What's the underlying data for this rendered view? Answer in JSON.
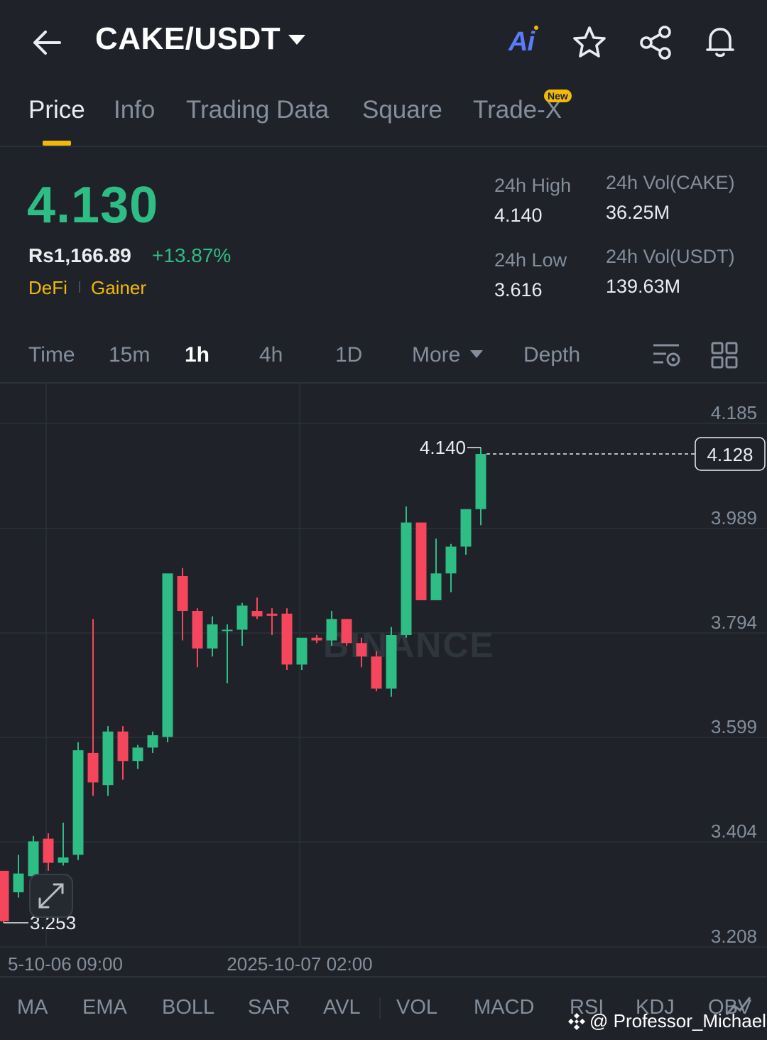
{
  "header": {
    "pair": "CAKE/USDT",
    "ai_label": "Ai",
    "icons": [
      "back-arrow-icon",
      "star-icon",
      "share-icon",
      "bell-icon"
    ]
  },
  "tabs": [
    {
      "label": "Price",
      "active": true
    },
    {
      "label": "Info"
    },
    {
      "label": "Trading Data"
    },
    {
      "label": "Square"
    },
    {
      "label": "Trade-X",
      "badge": "New"
    }
  ],
  "price": {
    "last": "4.130",
    "fiat": "Rs1,166.89",
    "change_pct": "+13.87%",
    "tags": [
      "DeFi",
      "Gainer"
    ]
  },
  "stats": {
    "high_label": "24h High",
    "high": "4.140",
    "low_label": "24h Low",
    "low": "3.616",
    "vol_base_label": "24h Vol(CAKE)",
    "vol_base": "36.25M",
    "vol_quote_label": "24h Vol(USDT)",
    "vol_quote": "139.63M"
  },
  "intervals": {
    "items": [
      "Time",
      "15m",
      "1h",
      "4h",
      "1D"
    ],
    "active": "1h",
    "more": "More",
    "depth": "Depth"
  },
  "colors": {
    "up": "#2ebd85",
    "down": "#f6465d",
    "accent": "#f0b90b",
    "background": "#1f2329"
  },
  "chart_data": {
    "type": "candlestick",
    "y_ticks": [
      "4.185",
      "3.989",
      "3.794",
      "3.599",
      "3.404",
      "3.208"
    ],
    "ylim": [
      3.208,
      4.185
    ],
    "x_labels": [
      "5-10-06 09:00",
      "2025-10-07 02:00"
    ],
    "current_price": "4.128",
    "high_marker": "4.140",
    "low_marker": "3.253",
    "watermark": "BINANCE",
    "candles": [
      {
        "o": 3.35,
        "h": 3.35,
        "l": 3.253,
        "c": 3.256
      },
      {
        "o": 3.31,
        "h": 3.38,
        "l": 3.3,
        "c": 3.345
      },
      {
        "o": 3.34,
        "h": 3.415,
        "l": 3.32,
        "c": 3.405
      },
      {
        "o": 3.41,
        "h": 3.42,
        "l": 3.35,
        "c": 3.365
      },
      {
        "o": 3.365,
        "h": 3.44,
        "l": 3.36,
        "c": 3.375
      },
      {
        "o": 3.38,
        "h": 3.59,
        "l": 3.37,
        "c": 3.575
      },
      {
        "o": 3.57,
        "h": 3.82,
        "l": 3.49,
        "c": 3.515
      },
      {
        "o": 3.51,
        "h": 3.62,
        "l": 3.49,
        "c": 3.61
      },
      {
        "o": 3.61,
        "h": 3.62,
        "l": 3.52,
        "c": 3.555
      },
      {
        "o": 3.555,
        "h": 3.585,
        "l": 3.54,
        "c": 3.58
      },
      {
        "o": 3.58,
        "h": 3.61,
        "l": 3.57,
        "c": 3.603
      },
      {
        "o": 3.6,
        "h": 3.83,
        "l": 3.59,
        "c": 3.905
      },
      {
        "o": 3.9,
        "h": 3.915,
        "l": 3.78,
        "c": 3.835
      },
      {
        "o": 3.835,
        "h": 3.84,
        "l": 3.73,
        "c": 3.765
      },
      {
        "o": 3.765,
        "h": 3.825,
        "l": 3.75,
        "c": 3.81
      },
      {
        "o": 3.8,
        "h": 3.81,
        "l": 3.7,
        "c": 3.8
      },
      {
        "o": 3.8,
        "h": 3.85,
        "l": 3.77,
        "c": 3.845
      },
      {
        "o": 3.835,
        "h": 3.86,
        "l": 3.82,
        "c": 3.825
      },
      {
        "o": 3.83,
        "h": 3.84,
        "l": 3.79,
        "c": 3.826
      },
      {
        "o": 3.83,
        "h": 3.84,
        "l": 3.725,
        "c": 3.735
      },
      {
        "o": 3.735,
        "h": 3.78,
        "l": 3.725,
        "c": 3.785
      },
      {
        "o": 3.785,
        "h": 3.79,
        "l": 3.775,
        "c": 3.78
      },
      {
        "o": 3.78,
        "h": 3.835,
        "l": 3.77,
        "c": 3.82
      },
      {
        "o": 3.82,
        "h": 3.82,
        "l": 3.77,
        "c": 3.775
      },
      {
        "o": 3.775,
        "h": 3.785,
        "l": 3.73,
        "c": 3.75
      },
      {
        "o": 3.75,
        "h": 3.76,
        "l": 3.685,
        "c": 3.69
      },
      {
        "o": 3.69,
        "h": 3.805,
        "l": 3.675,
        "c": 3.79
      },
      {
        "o": 3.79,
        "h": 4.03,
        "l": 3.785,
        "c": 4.0
      },
      {
        "o": 4.0,
        "h": 4.0,
        "l": 3.865,
        "c": 3.855
      },
      {
        "o": 3.855,
        "h": 3.97,
        "l": 3.86,
        "c": 3.905
      },
      {
        "o": 3.905,
        "h": 3.96,
        "l": 3.87,
        "c": 3.955
      },
      {
        "o": 3.955,
        "h": 4.015,
        "l": 3.94,
        "c": 4.025
      },
      {
        "o": 4.025,
        "h": 4.14,
        "l": 3.995,
        "c": 4.128
      }
    ]
  },
  "indicators": [
    "MA",
    "EMA",
    "BOLL",
    "SAR",
    "AVL",
    "VOL",
    "MACD",
    "RSI",
    "KDJ",
    "OBV"
  ],
  "credit": "@ Professor_Michael"
}
